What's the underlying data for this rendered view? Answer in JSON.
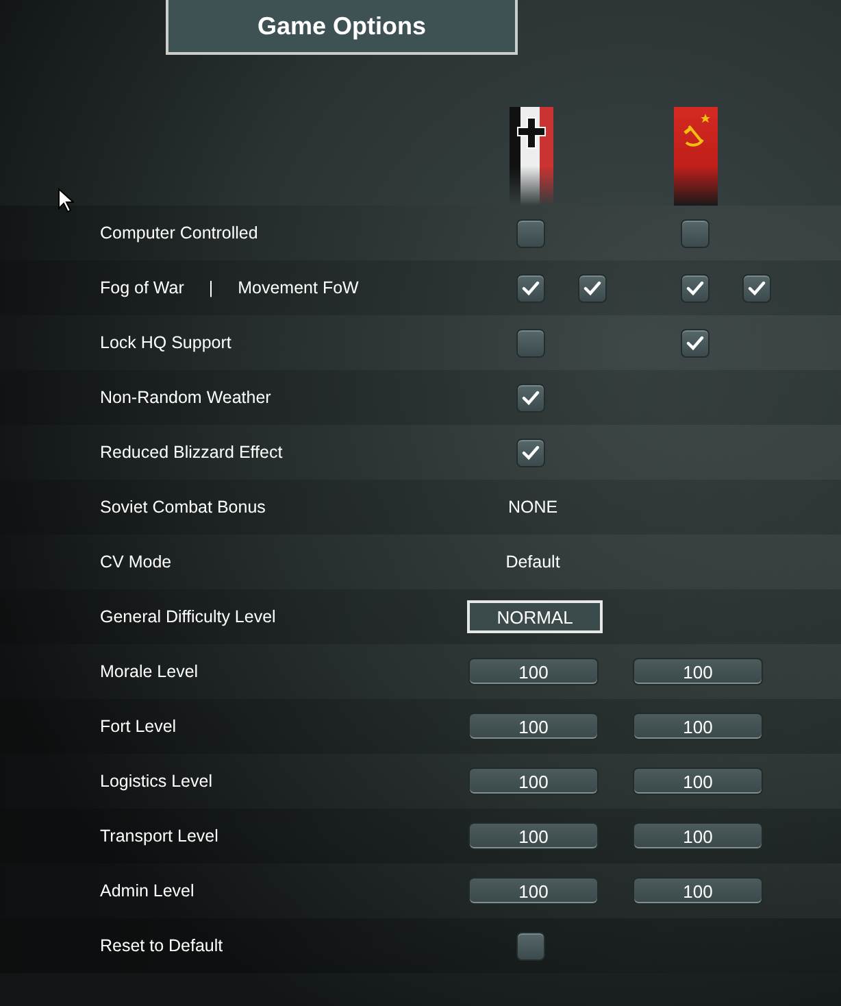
{
  "title": "Game Options",
  "sides": [
    {
      "kind": "germany"
    },
    {
      "kind": "soviet"
    }
  ],
  "rows": [
    {
      "labels": [
        "Computer Controlled"
      ],
      "cells": [
        [
          {
            "kind": "checkbox",
            "checked": false
          }
        ],
        [
          {
            "kind": "checkbox",
            "checked": false
          }
        ]
      ]
    },
    {
      "labels": [
        "Fog of War",
        "|",
        "Movement FoW"
      ],
      "cells": [
        [
          {
            "kind": "checkbox",
            "checked": true
          },
          {
            "kind": "checkbox",
            "checked": true
          }
        ],
        [
          {
            "kind": "checkbox",
            "checked": true
          },
          {
            "kind": "checkbox",
            "checked": true
          }
        ]
      ]
    },
    {
      "labels": [
        "Lock HQ Support"
      ],
      "cells": [
        [
          {
            "kind": "checkbox",
            "checked": false
          }
        ],
        [
          {
            "kind": "checkbox",
            "checked": true
          }
        ]
      ]
    },
    {
      "labels": [
        "Non-Random Weather"
      ],
      "cells": [
        [
          {
            "kind": "checkbox",
            "checked": true
          }
        ]
      ]
    },
    {
      "labels": [
        "Reduced Blizzard Effect"
      ],
      "cells": [
        [
          {
            "kind": "checkbox",
            "checked": true
          }
        ]
      ]
    },
    {
      "labels": [
        "Soviet Combat Bonus"
      ],
      "cells": [
        [
          {
            "kind": "text",
            "text": "NONE"
          }
        ]
      ]
    },
    {
      "labels": [
        "CV Mode"
      ],
      "cells": [
        [
          {
            "kind": "text",
            "text": "Default"
          }
        ]
      ]
    },
    {
      "labels": [
        "General Difficulty Level"
      ],
      "cells": [
        [
          {
            "kind": "button",
            "text": "NORMAL"
          }
        ]
      ]
    },
    {
      "labels": [
        "Morale Level"
      ],
      "cells": [
        [
          {
            "kind": "field",
            "text": "100"
          }
        ],
        [
          {
            "kind": "field",
            "text": "100"
          }
        ]
      ]
    },
    {
      "labels": [
        "Fort Level"
      ],
      "cells": [
        [
          {
            "kind": "field",
            "text": "100"
          }
        ],
        [
          {
            "kind": "field",
            "text": "100"
          }
        ]
      ]
    },
    {
      "labels": [
        "Logistics Level"
      ],
      "cells": [
        [
          {
            "kind": "field",
            "text": "100"
          }
        ],
        [
          {
            "kind": "field",
            "text": "100"
          }
        ]
      ]
    },
    {
      "labels": [
        "Transport Level"
      ],
      "cells": [
        [
          {
            "kind": "field",
            "text": "100"
          }
        ],
        [
          {
            "kind": "field",
            "text": "100"
          }
        ]
      ]
    },
    {
      "labels": [
        "Admin Level"
      ],
      "cells": [
        [
          {
            "kind": "field",
            "text": "100"
          }
        ],
        [
          {
            "kind": "field",
            "text": "100"
          }
        ]
      ]
    },
    {
      "labels": [
        "Reset to Default"
      ],
      "cells": [
        [
          {
            "kind": "checkbox",
            "checked": false
          }
        ]
      ]
    }
  ]
}
